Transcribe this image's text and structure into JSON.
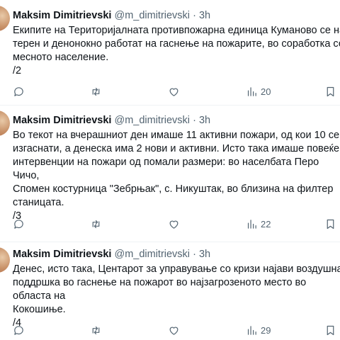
{
  "tweets": [
    {
      "author_name": "Maksim Dimitrievski",
      "handle": "@m_dimitrievski",
      "separator": "·",
      "time": "3h",
      "text": "Екипите на Територијалната противпожарна единица Куманово се на\nтерен и денонокно работат на гаснење на пожарите, во соработка со\nмесното население.\n/2",
      "views": "20"
    },
    {
      "author_name": "Maksim Dimitrievski",
      "handle": "@m_dimitrievski",
      "separator": "·",
      "time": "3h",
      "text": "Во текот на вчерашниот ден имаше 11 активни пожари, од кои 10 се\nизгаснати, а денеска има 2 нови и активни. Исто така имаше повеќе\nинтервенции на пожари од помали размери: во населбата Перо Чичо,\nСпомен костурница \"Зебрњак\", с. Никуштак, во близина на филтер\nстаницата.\n/3",
      "views": "22"
    },
    {
      "author_name": "Maksim Dimitrievski",
      "handle": "@m_dimitrievski",
      "separator": "·",
      "time": "3h",
      "text": "Денес, исто така, Центарот за управување со кризи најави воздушна\nподдршка во гаснење на пожарот во најзагрозеното место во областа на\nКокошиње.\n/4",
      "views": "29"
    }
  ],
  "icons": {
    "reply": "comment-icon",
    "retweet": "retweet-icon",
    "like": "heart-icon",
    "views": "analytics-icon",
    "bookmark": "bookmark-icon"
  },
  "colors": {
    "text": "#0f1419",
    "secondary": "#536471",
    "divider": "#eff3f4"
  }
}
